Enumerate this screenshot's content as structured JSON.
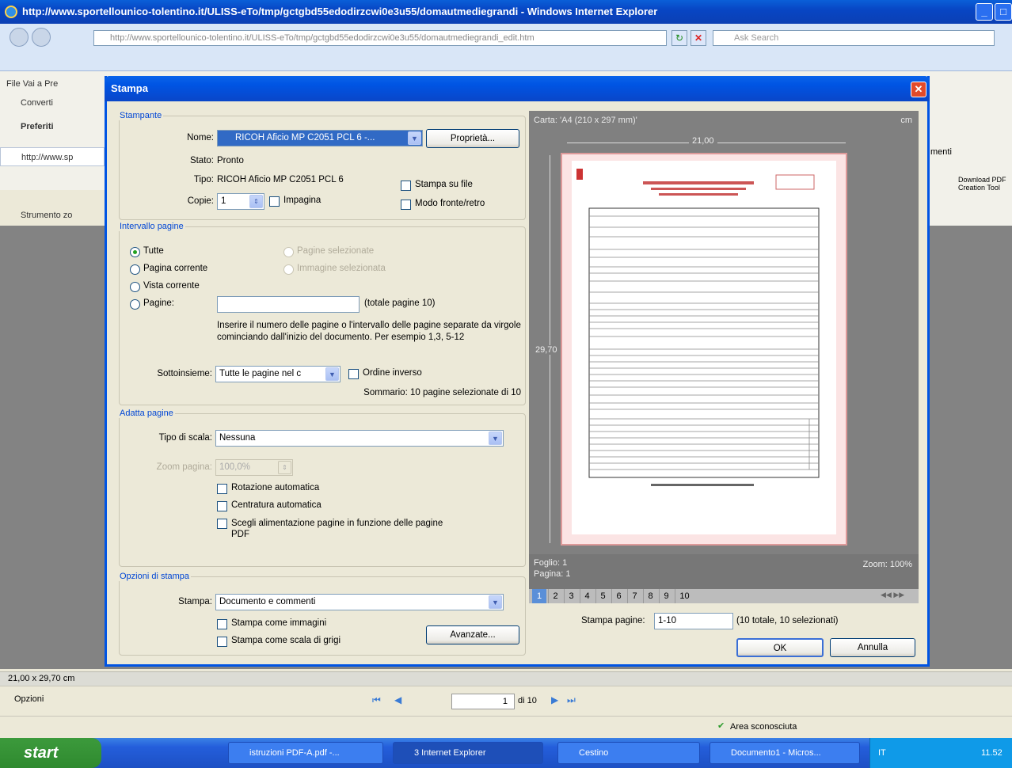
{
  "ie": {
    "title": "http://www.sportellounico-tolentino.it/ULISS-eTo/tmp/gctgbd55edodirzcwi0e3u55/domautmediegrandi - Windows Internet Explorer",
    "address": "http://www.sportellounico-tolentino.it/ULISS-eTo/tmp/gctgbd55edodirzcwi0e3u55/domautmediegrandi_edit.htm",
    "search_placeholder": "Ask Search",
    "menu": "File  Vai a  Pre",
    "converti": "Converti",
    "preferiti": "Preferiti",
    "tab": "http://www.sp",
    "strumento": "Strumento zo",
    "strumenti": "menti",
    "download_pdf": "Download PDF Creation Tool"
  },
  "dialog": {
    "title": "Stampa",
    "stampante": {
      "legend": "Stampante",
      "nome_label": "Nome:",
      "nome_value": "RICOH Aficio MP C2051 PCL 6 -...",
      "proprieta": "Proprietà...",
      "stato_label": "Stato:",
      "stato_value": "Pronto",
      "tipo_label": "Tipo:",
      "tipo_value": "RICOH Aficio MP C2051 PCL 6",
      "copie_label": "Copie:",
      "copie_value": "1",
      "impagina": "Impagina",
      "stampa_su_file": "Stampa su file",
      "fronte_retro": "Modo fronte/retro"
    },
    "intervallo": {
      "legend": "Intervallo pagine",
      "tutte": "Tutte",
      "pagina_corrente": "Pagina corrente",
      "vista_corrente": "Vista corrente",
      "pagine": "Pagine:",
      "pagine_selezionate": "Pagine selezionate",
      "immagine_selezionata": "Immagine selezionata",
      "totale": "(totale pagine 10)",
      "help": "Inserire il numero delle pagine o l'intervallo delle pagine separate da virgole cominciando dall'inizio del documento. Per esempio 1,3, 5-12",
      "sottoinsieme_label": "Sottoinsieme:",
      "sottoinsieme_value": "Tutte le pagine nel c",
      "ordine_inverso": "Ordine inverso",
      "sommario": "Sommario: 10 pagine selezionate di 10"
    },
    "adatta": {
      "legend": "Adatta pagine",
      "tipo_label": "Tipo di scala:",
      "tipo_value": "Nessuna",
      "zoom_label": "Zoom pagina:",
      "zoom_value": "100,0%",
      "rotazione": "Rotazione automatica",
      "centratura": "Centratura automatica",
      "alimentazione": "Scegli alimentazione pagine in funzione delle pagine PDF"
    },
    "opzioni": {
      "legend": "Opzioni di stampa",
      "stampa_label": "Stampa:",
      "stampa_value": "Documento e commenti",
      "immagini": "Stampa come immagini",
      "grigi": "Stampa come scala di grigi",
      "avanzate": "Avanzate..."
    },
    "preview": {
      "carta": "Carta: 'A4 (210 x 297 mm)'",
      "cm": "cm",
      "width": "21,00",
      "height": "29,70",
      "foglio": "Foglio: 1",
      "pagina": "Pagina: 1",
      "zoom": "Zoom: 100%",
      "pages": [
        "1",
        "2",
        "3",
        "4",
        "5",
        "6",
        "7",
        "8",
        "9",
        "10"
      ]
    },
    "stampa_pagine_label": "Stampa pagine:",
    "stampa_pagine_value": "1-10",
    "stampa_pagine_info": "(10 totale, 10 selezionati)",
    "ok": "OK",
    "annulla": "Annulla"
  },
  "bottom": {
    "page_size": "21,00 x 29,70 cm",
    "opzioni": "Opzioni",
    "page_num": "1",
    "page_of": "di 10",
    "area": "Area sconosciuta"
  },
  "taskbar": {
    "start": "start",
    "items": [
      "istruzioni PDF-A.pdf -...",
      "3 Internet Explorer",
      "Cestino",
      "Documento1 - Micros..."
    ],
    "lang": "IT",
    "time": "11.52"
  },
  "colors": {
    "xp_blue": "#0054e3",
    "legend_blue": "#0046d5",
    "preview_gray": "#808080"
  }
}
